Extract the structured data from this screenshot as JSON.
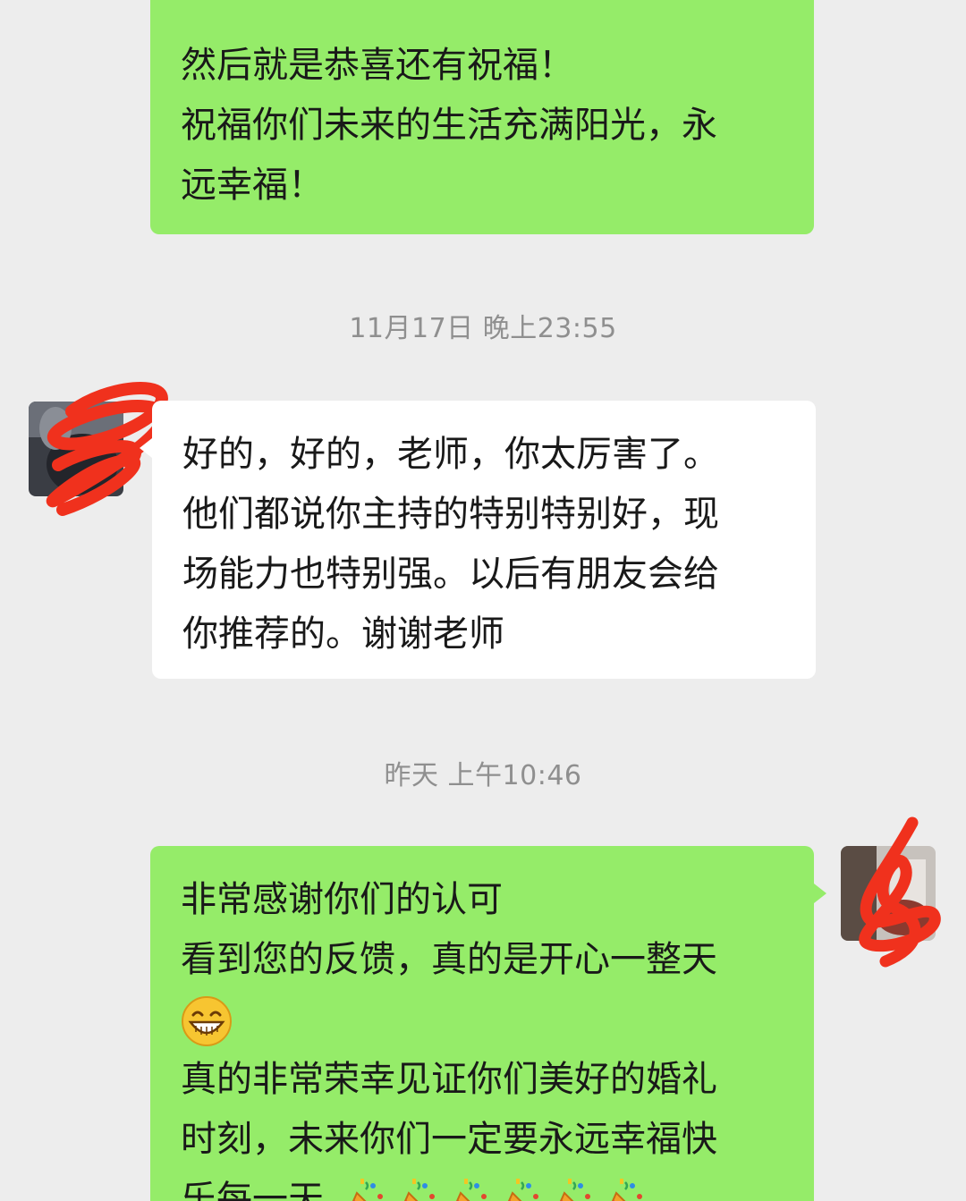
{
  "messages": [
    {
      "side": "out",
      "lines": [
        "然后就是恭喜还有祝福！",
        "祝福你们未来的生活充满阳光，永",
        "远幸福！"
      ]
    },
    {
      "side": "in",
      "lines": [
        "好的，好的，老师，你太厉害了。",
        "他们都说你主持的特别特别好，现",
        "场能力也特别强。以后有朋友会给",
        "你推荐的。谢谢老师"
      ]
    },
    {
      "side": "out",
      "lines": [
        "非常感谢你们的认可",
        "看到您的反馈，真的是开心一整天",
        "",
        "真的非常荣幸见证你们美好的婚礼",
        "时刻，未来你们一定要永远幸福快",
        "乐每一天"
      ]
    }
  ],
  "timestamps": {
    "t1": "11月17日 晚上23:55",
    "t2": "昨天 上午10:46"
  },
  "icons": {
    "grin": "grinning-face-emoji",
    "party": "party-popper-emoji",
    "avatar_scribble": "red-scribble-redaction"
  },
  "colors": {
    "background": "#ededed",
    "outgoing_bubble": "#95ec69",
    "incoming_bubble": "#ffffff",
    "timestamp_text": "#8f8f8f",
    "redaction": "#f0311d"
  }
}
